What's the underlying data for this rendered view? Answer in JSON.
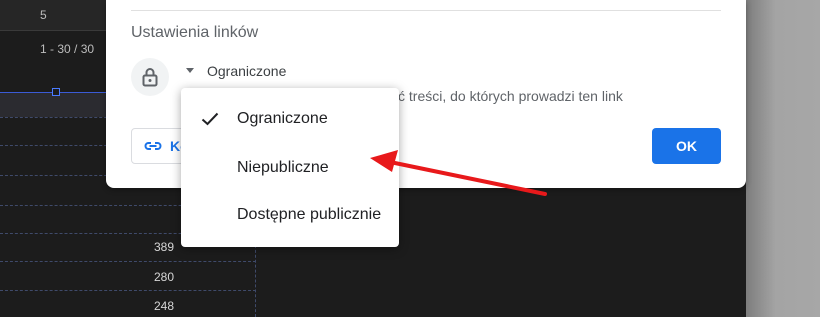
{
  "background": {
    "header_number": "5",
    "pagination": "1 - 30 / 30",
    "cell_values": [
      "389",
      "280",
      "248"
    ]
  },
  "dialog": {
    "section_title": "Ustawienia linków",
    "access_value": "Ograniczone",
    "access_description": "ć treści, do których prowadzi ten link",
    "copy_button_label": "Ko",
    "ok_button_label": "OK"
  },
  "menu": {
    "items": [
      {
        "label": "Ograniczone",
        "selected": true
      },
      {
        "label": "Niepubliczne",
        "selected": false
      },
      {
        "label": "Dostępne publicznie",
        "selected": false
      }
    ]
  },
  "colors": {
    "accent": "#1a73e8",
    "annotation_arrow": "#e8191b",
    "background_dark": "#1c1c1c"
  },
  "icons": [
    "lock-icon",
    "link-icon",
    "checkmark-icon",
    "dropdown-caret-icon"
  ]
}
